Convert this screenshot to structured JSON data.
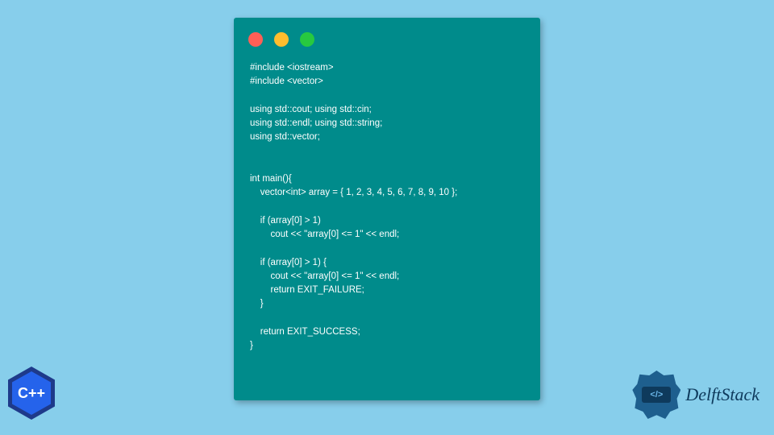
{
  "code": {
    "line1": "#include <iostream>",
    "line2": "#include <vector>",
    "line3": "using std::cout; using std::cin;",
    "line4": "using std::endl; using std::string;",
    "line5": "using std::vector;",
    "line6": "int main(){",
    "line7": "    vector<int> array = { 1, 2, 3, 4, 5, 6, 7, 8, 9, 10 };",
    "line8": "    if (array[0] > 1)",
    "line9": "        cout << \"array[0] <= 1\" << endl;",
    "line10": "    if (array[0] > 1) {",
    "line11": "        cout << \"array[0] <= 1\" << endl;",
    "line12": "        return EXIT_FAILURE;",
    "line13": "    }",
    "line14": "    return EXIT_SUCCESS;",
    "line15": "}"
  },
  "badges": {
    "cpp": "C++",
    "ds_icon": "</>",
    "ds_text": "DelftStack"
  }
}
